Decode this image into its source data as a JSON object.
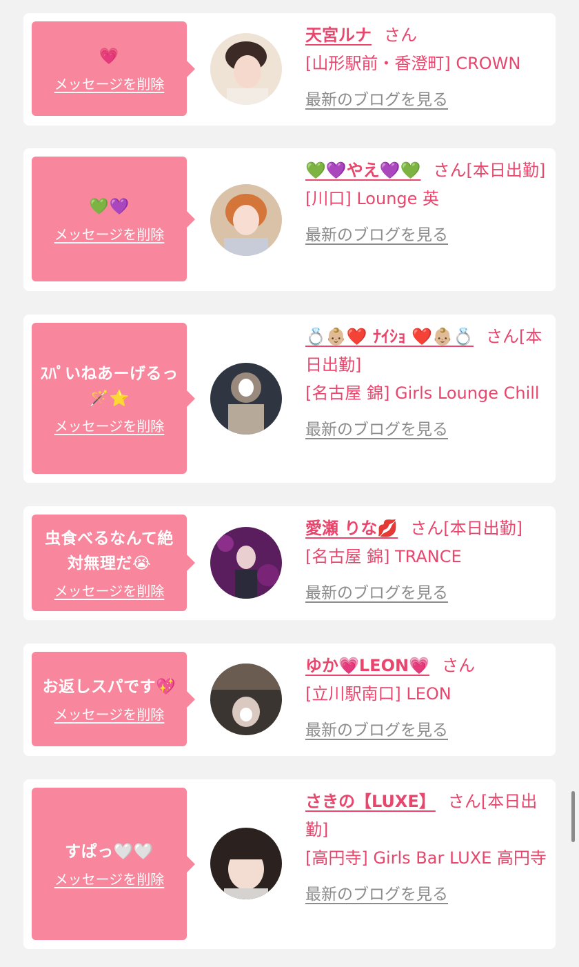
{
  "delete_label": "メッセージを削除",
  "blog_label": "最新のブログを見る",
  "san_suffix": "さん",
  "items": [
    {
      "message": "💗",
      "name": "天宮ルナ",
      "suffix": "さん",
      "shop": "[山形駅前・香澄町] CROWN"
    },
    {
      "message": "💚💜",
      "name": "💚💜やえ💜💚",
      "suffix": "さん[本日出勤]",
      "shop": "[川口] Lounge 英"
    },
    {
      "message": "ｽﾊﾟいねあーげるっ🪄⭐️",
      "name": "💍👶🏼❤️ ﾅｲｼｮ ❤️👶🏼💍",
      "suffix": "さん[本日出勤]",
      "shop": "[名古屋 錦] Girls Lounge Chill"
    },
    {
      "message": "虫食べるなんて絶対無理だ😭",
      "name": "愛瀬 りな💋",
      "suffix": "さん[本日出勤]",
      "shop": "[名古屋 錦] TRANCE"
    },
    {
      "message": "お返しスパです💖",
      "name": "ゆか💗LEON💗",
      "suffix": "さん",
      "shop": "[立川駅南口] LEON"
    },
    {
      "message": "すぱっ🤍🤍",
      "name": "さきの【LUXE】",
      "suffix": "さん[本日出勤]",
      "shop": "[高円寺] Girls Bar LUXE 高円寺"
    }
  ],
  "colors": {
    "page_bg": "#f2f2f2",
    "card_bg": "#ffffff",
    "bubble_bg": "#f8879d",
    "accent_text": "#e8466c",
    "link_gray": "#8c8c8c"
  }
}
